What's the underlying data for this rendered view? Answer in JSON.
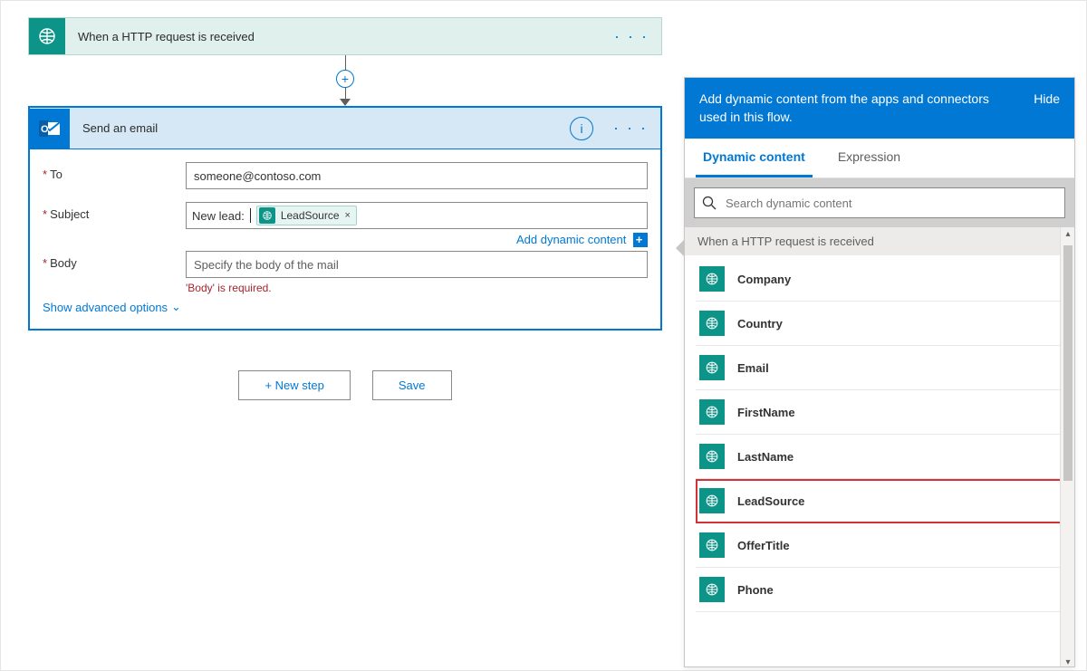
{
  "trigger": {
    "title": "When a HTTP request is received"
  },
  "email_action": {
    "title": "Send an email",
    "fields": {
      "to_label": "To",
      "to_value": "someone@contoso.com",
      "subject_label": "Subject",
      "subject_prefix": "New lead:",
      "subject_token": "LeadSource",
      "add_dynamic_link": "Add dynamic content",
      "body_label": "Body",
      "body_placeholder": "Specify the body of the mail",
      "body_error": "'Body' is required."
    },
    "advanced_link": "Show advanced options"
  },
  "buttons": {
    "new_step": "+ New step",
    "save": "Save"
  },
  "dyn_panel": {
    "header": "Add dynamic content from the apps and connectors used in this flow.",
    "hide": "Hide",
    "tabs": {
      "dynamic": "Dynamic content",
      "expression": "Expression"
    },
    "search_placeholder": "Search dynamic content",
    "section": "When a HTTP request is received",
    "items": [
      "Company",
      "Country",
      "Email",
      "FirstName",
      "LastName",
      "LeadSource",
      "OfferTitle",
      "Phone"
    ],
    "highlighted": "LeadSource"
  }
}
